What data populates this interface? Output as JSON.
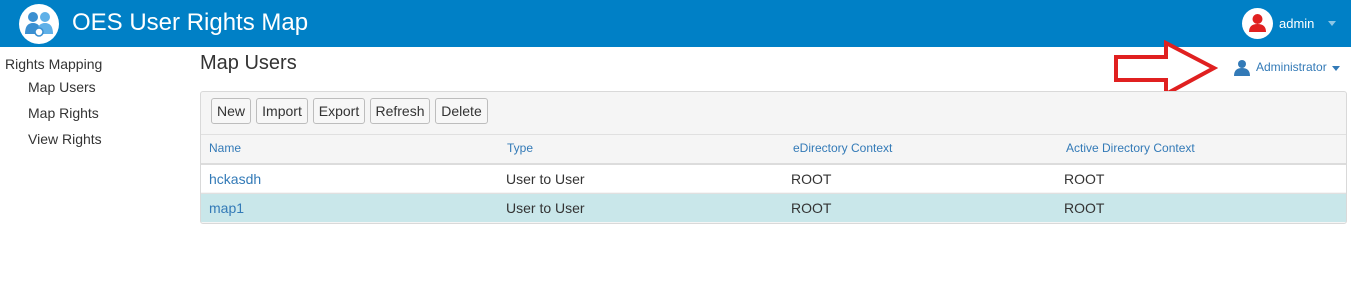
{
  "header": {
    "title": "OES User Rights Map",
    "user": "admin",
    "accent": "#0080c6"
  },
  "sidebar": {
    "heading": "Rights Mapping",
    "items": [
      {
        "label": "Map Users"
      },
      {
        "label": "Map Rights"
      },
      {
        "label": "View Rights"
      }
    ]
  },
  "main": {
    "title": "Map Users",
    "role": "Administrator",
    "toolbar": {
      "new": "New",
      "import": "Import",
      "export": "Export",
      "refresh": "Refresh",
      "delete": "Delete"
    },
    "table": {
      "columns": [
        "Name",
        "Type",
        "eDirectory Context",
        "Active Directory Context"
      ],
      "rows": [
        {
          "name": "hckasdh",
          "type": "User to User",
          "edir": "ROOT",
          "ad": "ROOT"
        },
        {
          "name": "map1",
          "type": "User to User",
          "edir": "ROOT",
          "ad": "ROOT",
          "selected": true
        }
      ]
    }
  },
  "annotation": {
    "arrow_color": "#e02020"
  }
}
